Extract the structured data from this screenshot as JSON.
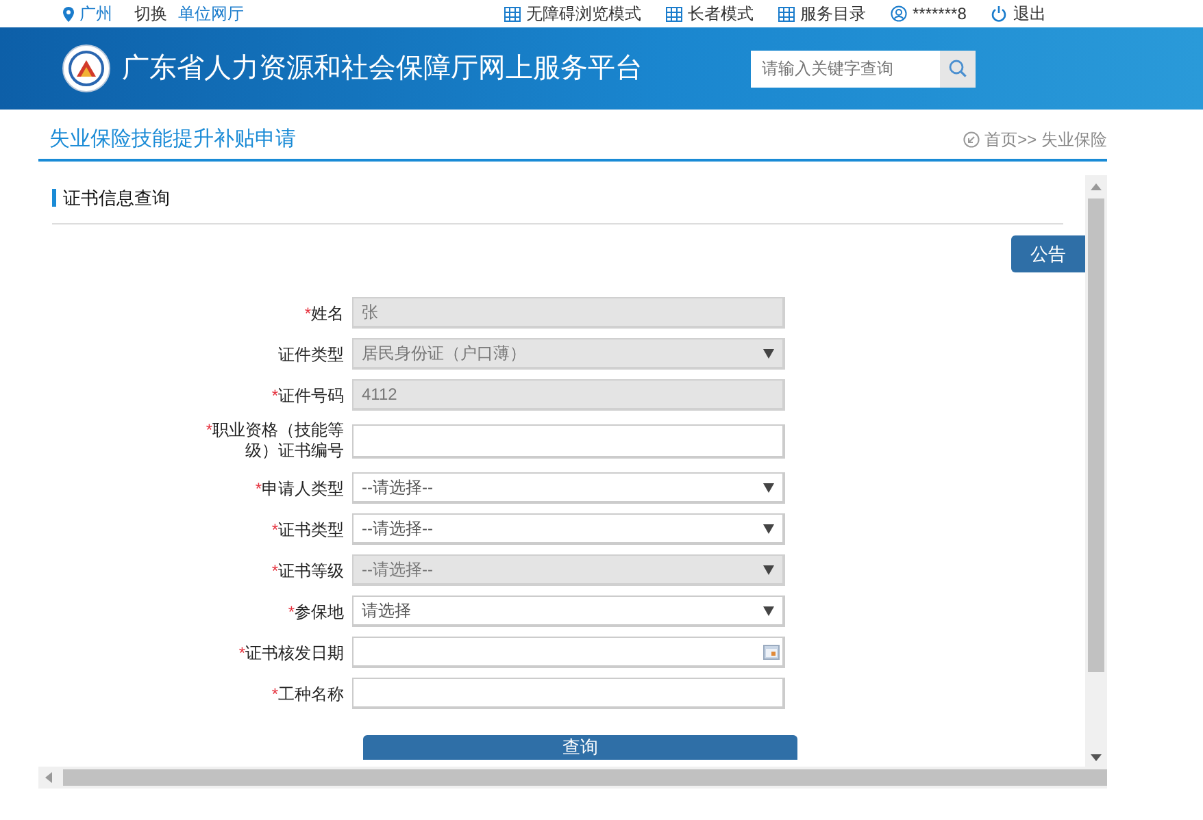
{
  "top_bar": {
    "location": "广州",
    "switch": "切换",
    "switch_link": "单位网厅",
    "links": [
      {
        "kind": "grid",
        "label": "无障碍浏览模式"
      },
      {
        "kind": "grid",
        "label": "长者模式"
      },
      {
        "kind": "grid",
        "label": "服务目录"
      },
      {
        "kind": "user",
        "label": "*******8"
      },
      {
        "kind": "power",
        "label": "退出"
      }
    ]
  },
  "header": {
    "title": "广东省人力资源和社会保障厅网上服务平台",
    "search": {
      "placeholder": "请输入关键字查询"
    }
  },
  "page": {
    "title": "失业保险技能提升补贴申请",
    "breadcrumb": "首页>> 失业保险"
  },
  "section": {
    "title": "证书信息查询",
    "notice_button": "公告"
  },
  "form": {
    "fields": [
      {
        "label": "姓名",
        "required_mark": "*",
        "kind": "text",
        "value": "张",
        "disabled": true
      },
      {
        "label": "证件类型",
        "kind": "select",
        "value": "居民身份证（户口薄）",
        "disabled": true
      },
      {
        "label": "证件号码",
        "required_mark": "*",
        "kind": "text",
        "value": "4112",
        "disabled": true
      },
      {
        "label": "职业资格（技能等级）证书编号",
        "required_mark": "*",
        "kind": "text",
        "disabled": false
      },
      {
        "label": "申请人类型",
        "required_mark": "*",
        "kind": "select",
        "value": "--请选择--",
        "disabled": false
      },
      {
        "label": "证书类型",
        "required_mark": "*",
        "kind": "select",
        "value": "--请选择--",
        "disabled": false
      },
      {
        "label": "证书等级",
        "required_mark": "*",
        "kind": "select",
        "value": "--请选择--",
        "disabled": true
      },
      {
        "label": "参保地",
        "required_mark": "*",
        "kind": "select",
        "value": "请选择",
        "disabled": false
      },
      {
        "label": "证书核发日期",
        "required_mark": "*",
        "kind": "date",
        "disabled": false
      },
      {
        "label": "工种名称",
        "required_mark": "*",
        "kind": "text",
        "disabled": false
      }
    ],
    "submit": "查询"
  }
}
